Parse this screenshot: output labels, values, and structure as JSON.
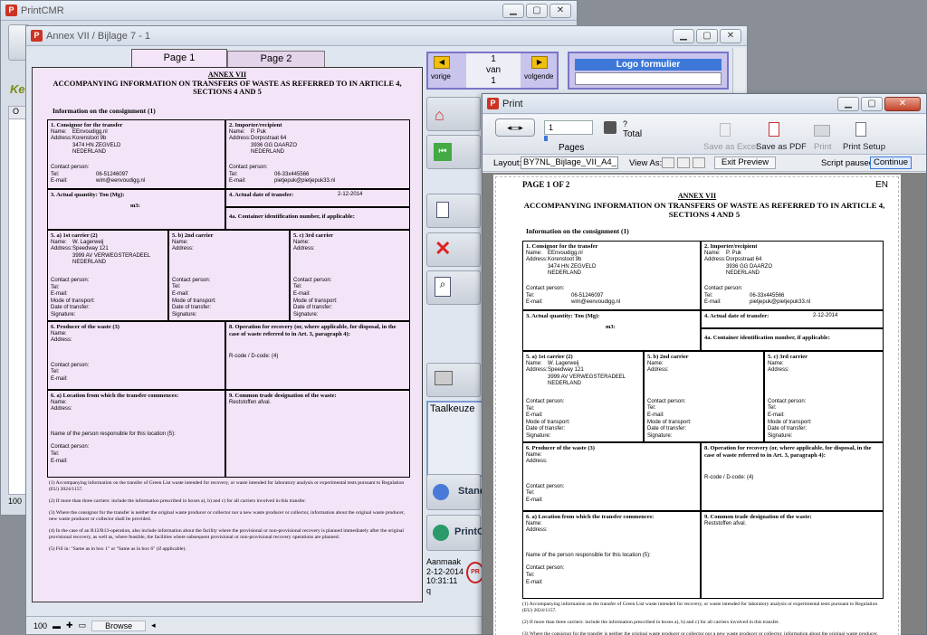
{
  "win1": {
    "title": "PrintCMR",
    "label_ke": "Ke",
    "label_o": "O",
    "status_100": "100"
  },
  "win2": {
    "title": "Annex VII / Bijlage 7 - 1",
    "tabs": [
      "Page 1",
      "Page 2"
    ],
    "nav": {
      "prev": "vorige",
      "page": "1",
      "of": "van",
      "total": "1",
      "next": "volgende"
    },
    "logo_label": "Logo formulier",
    "taalkeuze": "Taalkeuze",
    "stand_label": "Stand",
    "printcm_label": "PrintCM",
    "aanmaak": {
      "label": "Aanmaak",
      "date": "2-12-2014",
      "time": "10:31:11",
      "user": "q"
    },
    "bottom": {
      "zoom": "100",
      "mode": "Browse"
    }
  },
  "form": {
    "annex": "ANNEX VII",
    "title": "ACCOMPANYING INFORMATION ON TRANSFERS OF WASTE AS REFERRED TO IN ARTICLE 4, SECTIONS 4 AND 5",
    "info_heading": "Information on the consignment (1)",
    "labels": {
      "name": "Name:",
      "address": "Address:",
      "contact": "Contact person:",
      "tel": "Tel:",
      "email": "E-mail:",
      "mode": "Mode of transport:",
      "date": "Date of transfer:",
      "signature": "Signature:",
      "r_code": "R-code / D-code: (4)",
      "responsible": "Name of the person responsible for this location (5):",
      "m3": "m3:"
    },
    "box1": {
      "title": "1. Consignor for the transfer",
      "name": "EEnvoudigg.nl",
      "addr1": "Korenstoot 9b",
      "addr2": "3474 HN  ZEGVELD",
      "addr3": "NEDERLAND",
      "tel": "06-51246097",
      "email": "wim@eenvoudigg.nl"
    },
    "box2": {
      "title": "2. Importer/recipient",
      "name": "P. Puk",
      "addr1": "Dorpsstraat 64",
      "addr2": "3936 GG  DAARZO",
      "addr3": "NEDERLAND",
      "tel": "06-33x445566",
      "email": "pietjepuk@pietjepuk33.nl"
    },
    "box3": {
      "title": "3. Actual quantity: Ton (Mg):"
    },
    "box4": {
      "title": "4. Actual date of transfer:",
      "date": "2-12-2014"
    },
    "box4a": {
      "title": "4a. Container identification number, if applicable:"
    },
    "box5a": {
      "title": "5. a) 1st carrier (2)",
      "name": "W. Lagerweij",
      "addr1": "Speedway 121",
      "addr2": "3999 AV  VERWEGSTERADEEL",
      "addr3": "NEDERLAND"
    },
    "box5b": {
      "title": "5. b) 2nd carrier"
    },
    "box5c": {
      "title": "5. c) 3rd carrier"
    },
    "box6": {
      "title": "6. Producer of the waste (3)"
    },
    "box8": {
      "title": "8. Operation for recovery (or, where applicable, for disposal, in the case of waste referred to in Art. 3, paragraph 4):"
    },
    "box6a": {
      "title": "6. a) Location from which the transfer commences:"
    },
    "box9": {
      "title": "9. Common trade designation of the waste:",
      "value": "Reststoffen afval."
    },
    "footnotes": [
      "(1) Accompanying information on the transfer of Green List waste intended for recovery, or waste intended for laboratory analysis or experimental tests pursuant to Regulation (EU) 2024/1157.",
      "(2) If more than three carriers: include the information prescribed in boxes a), b) and c) for all carriers involved in this transfer.",
      "(3) Where the consignor for the transfer is neither the original waste producer or collector nor a new waste producer or collector, information about the original waste producer, new waste producer or collector shall be provided.",
      "(4) In the case of an R12/R13-operation, also include information about the facility where the provisional or non-provisional recovery is planned immediately after the original provisional recovery, as well as, where feasible, the facilities where subsequent provisional or non-provisional recovery operations are planned.",
      "(5) Fill in: \"Same as in box 1\" or \"Same as in box 6\" (if applicable)."
    ]
  },
  "print": {
    "title": "Print",
    "page_value": "1",
    "pages_label": "Pages",
    "total_label": "Total",
    "total_value": "?",
    "save_excel": "Save as Excel",
    "save_pdf": "Save as PDF",
    "print_btn": "Print",
    "print_setup": "Print Setup",
    "layout_label": "Layout:",
    "layout_value": "BY7NL_Bijlage_VII_A4_...",
    "view_as": "View As:",
    "exit_preview": "Exit Preview",
    "script_paused": "Script paused",
    "continue": "Continue",
    "page_of": "PAGE 1 OF 2",
    "lang": "EN"
  },
  "colors": {
    "form_bg": "#f4e4f8",
    "accent_blue": "#3d78d8",
    "nav_bg": "#c8c4ec"
  }
}
